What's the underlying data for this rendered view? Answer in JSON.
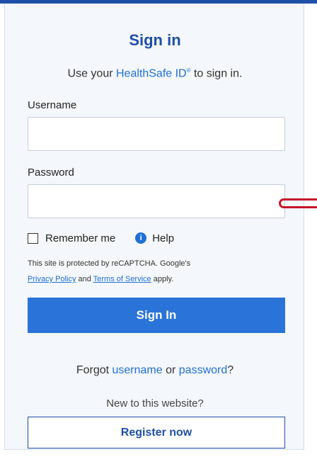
{
  "title": "Sign in",
  "subtitle": {
    "prefix": "Use your ",
    "link": "HealthSafe ID",
    "mark": "®",
    "suffix": " to sign in."
  },
  "username": {
    "label": "Username",
    "value": ""
  },
  "password": {
    "label": "Password",
    "value": ""
  },
  "remember": {
    "label": "Remember me",
    "checked": false
  },
  "help": {
    "label": "Help",
    "icon": "info-icon"
  },
  "recaptcha": {
    "text": "This site is protected by reCAPTCHA. Google's ",
    "privacy": "Privacy Policy",
    "and": " and ",
    "terms": "Terms of Service",
    "suffix": " apply."
  },
  "sign_in_button": "Sign In",
  "forgot": {
    "prefix": "Forgot ",
    "username": "username",
    "or": " or ",
    "password": "password",
    "suffix": "?"
  },
  "new_site": "New to this website?",
  "register_button": "Register now",
  "colors": {
    "primary": "#2a73d8",
    "brand": "#1f4fa8",
    "link": "#1f6fd6",
    "annotation": "#c4162a"
  }
}
